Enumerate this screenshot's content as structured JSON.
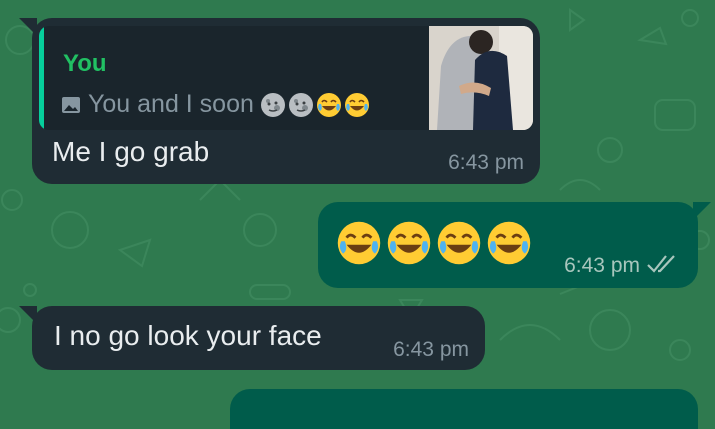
{
  "chat": {
    "messages": [
      {
        "direction": "incoming",
        "reply": {
          "author": "You",
          "icon": "photo-icon",
          "text": "You and I soon",
          "emojis": [
            "new-moon-face",
            "new-moon-face",
            "tears-of-joy",
            "tears-of-joy"
          ]
        },
        "text": "Me I go grab",
        "time": "6:43 pm"
      },
      {
        "direction": "outgoing",
        "emojis": [
          "tears-of-joy",
          "tears-of-joy",
          "tears-of-joy",
          "tears-of-joy"
        ],
        "time": "6:43 pm",
        "status_icon": "double-check-icon"
      },
      {
        "direction": "incoming",
        "text": "I no go look your face",
        "time": "6:43 pm"
      }
    ]
  },
  "colors": {
    "wallpaper": "#2f7a4f",
    "incoming_bubble": "#1f2c34",
    "outgoing_bubble": "#005c4b",
    "reply_author": "#21c063",
    "timestamp": "#8696a0"
  }
}
